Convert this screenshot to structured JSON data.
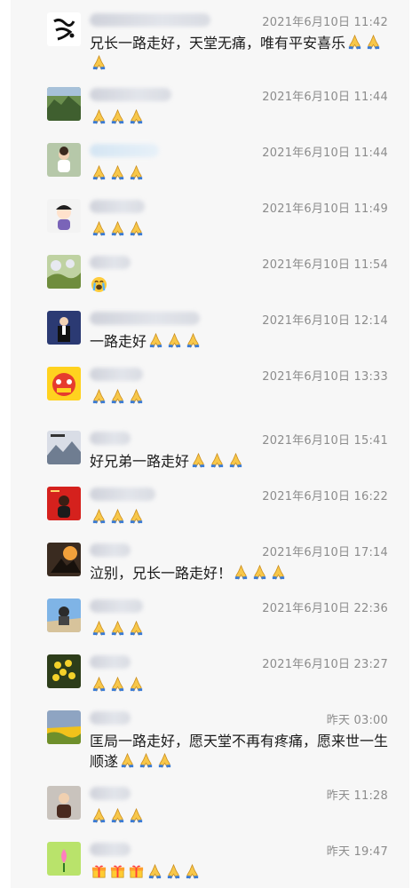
{
  "comments": [
    {
      "time": "2021年6月10日 11:42",
      "text": "兄长一路走好，天堂无痛，唯有平安喜乐",
      "trailing_emoji": "pray-x3-wrap"
    },
    {
      "time": "2021年6月10日 11:44",
      "text": "",
      "trailing_emoji": "pray-x3"
    },
    {
      "time": "2021年6月10日 11:44",
      "text": "",
      "trailing_emoji": "pray-x3"
    },
    {
      "time": "2021年6月10日 11:49",
      "text": "",
      "trailing_emoji": "pray-x3"
    },
    {
      "time": "2021年6月10日 11:54",
      "text": "",
      "trailing_emoji": "crying-face"
    },
    {
      "time": "2021年6月10日 12:14",
      "text": "一路走好",
      "trailing_emoji": "pray-x3"
    },
    {
      "time": "2021年6月10日 13:33",
      "text": "",
      "trailing_emoji": "pray-x3"
    },
    {
      "time": "2021年6月10日 15:41",
      "text": "好兄弟一路走好",
      "trailing_emoji": "pray-x3"
    },
    {
      "time": "2021年6月10日 16:22",
      "text": "",
      "trailing_emoji": "pray-x3"
    },
    {
      "time": "2021年6月10日 17:14",
      "text": "泣别，兄长一路走好！",
      "trailing_emoji": "pray-x3"
    },
    {
      "time": "2021年6月10日 22:36",
      "text": "",
      "trailing_emoji": "pray-x3"
    },
    {
      "time": "2021年6月10日 23:27",
      "text": "",
      "trailing_emoji": "pray-x3"
    },
    {
      "time": "昨天 03:00",
      "text": "匡局一路走好，愿天堂不再有疼痛，愿来世一生顺遂",
      "trailing_emoji": "pray-x3"
    },
    {
      "time": "昨天 11:28",
      "text": "",
      "trailing_emoji": "pray-x3"
    },
    {
      "time": "昨天 19:47",
      "text": "",
      "trailing_emoji": "gift-x3-pray-x3"
    }
  ],
  "icons": {
    "pray": "folded-hands-emoji",
    "cry": "loudly-crying-face-emoji",
    "gift": "gift-emoji"
  },
  "colors": {
    "panel_bg": "#f7f7f7",
    "time_text": "#8c8c8c",
    "body_text": "#1a1a1a"
  }
}
